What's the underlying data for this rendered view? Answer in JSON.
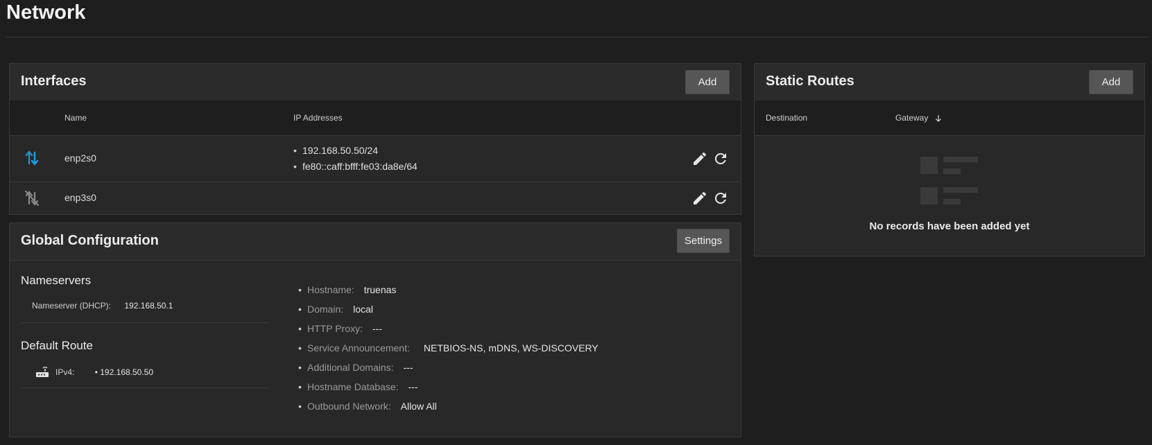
{
  "page": {
    "title": "Network"
  },
  "interfaces": {
    "title": "Interfaces",
    "add_label": "Add",
    "columns": {
      "name": "Name",
      "ip": "IP Addresses"
    },
    "rows": [
      {
        "name": "enp2s0",
        "status_icon": "link-up-icon",
        "ips": [
          "192.168.50.50/24",
          "fe80::caff:bfff:fe03:da8e/64"
        ]
      },
      {
        "name": "enp3s0",
        "status_icon": "link-down-icon",
        "ips": []
      }
    ]
  },
  "static_routes": {
    "title": "Static Routes",
    "add_label": "Add",
    "columns": {
      "destination": "Destination",
      "gateway": "Gateway"
    },
    "sort_icon": "arrow-down-icon",
    "empty_text": "No records have been added yet"
  },
  "global_config": {
    "title": "Global Configuration",
    "settings_label": "Settings",
    "nameservers": {
      "title": "Nameservers",
      "items": [
        {
          "label": "Nameserver (DHCP):",
          "value": "192.168.50.1"
        }
      ]
    },
    "default_route": {
      "title": "Default Route",
      "icon": "router-icon",
      "label": "IPv4:",
      "value": "192.168.50.50"
    },
    "settings": [
      {
        "label": "Hostname:",
        "value": "truenas"
      },
      {
        "label": "Domain:",
        "value": "local"
      },
      {
        "label": "HTTP Proxy:",
        "value": "---"
      },
      {
        "label": "Service Announcement:",
        "value": "NETBIOS-NS, mDNS, WS-DISCOVERY"
      },
      {
        "label": "Additional Domains:",
        "value": "---"
      },
      {
        "label": "Hostname Database:",
        "value": "---"
      },
      {
        "label": "Outbound Network:",
        "value": "Allow All"
      }
    ]
  },
  "colors": {
    "background": "#1e1e1e",
    "card": "#282828",
    "accent_link": "#1f9bde",
    "button": "#565656"
  }
}
